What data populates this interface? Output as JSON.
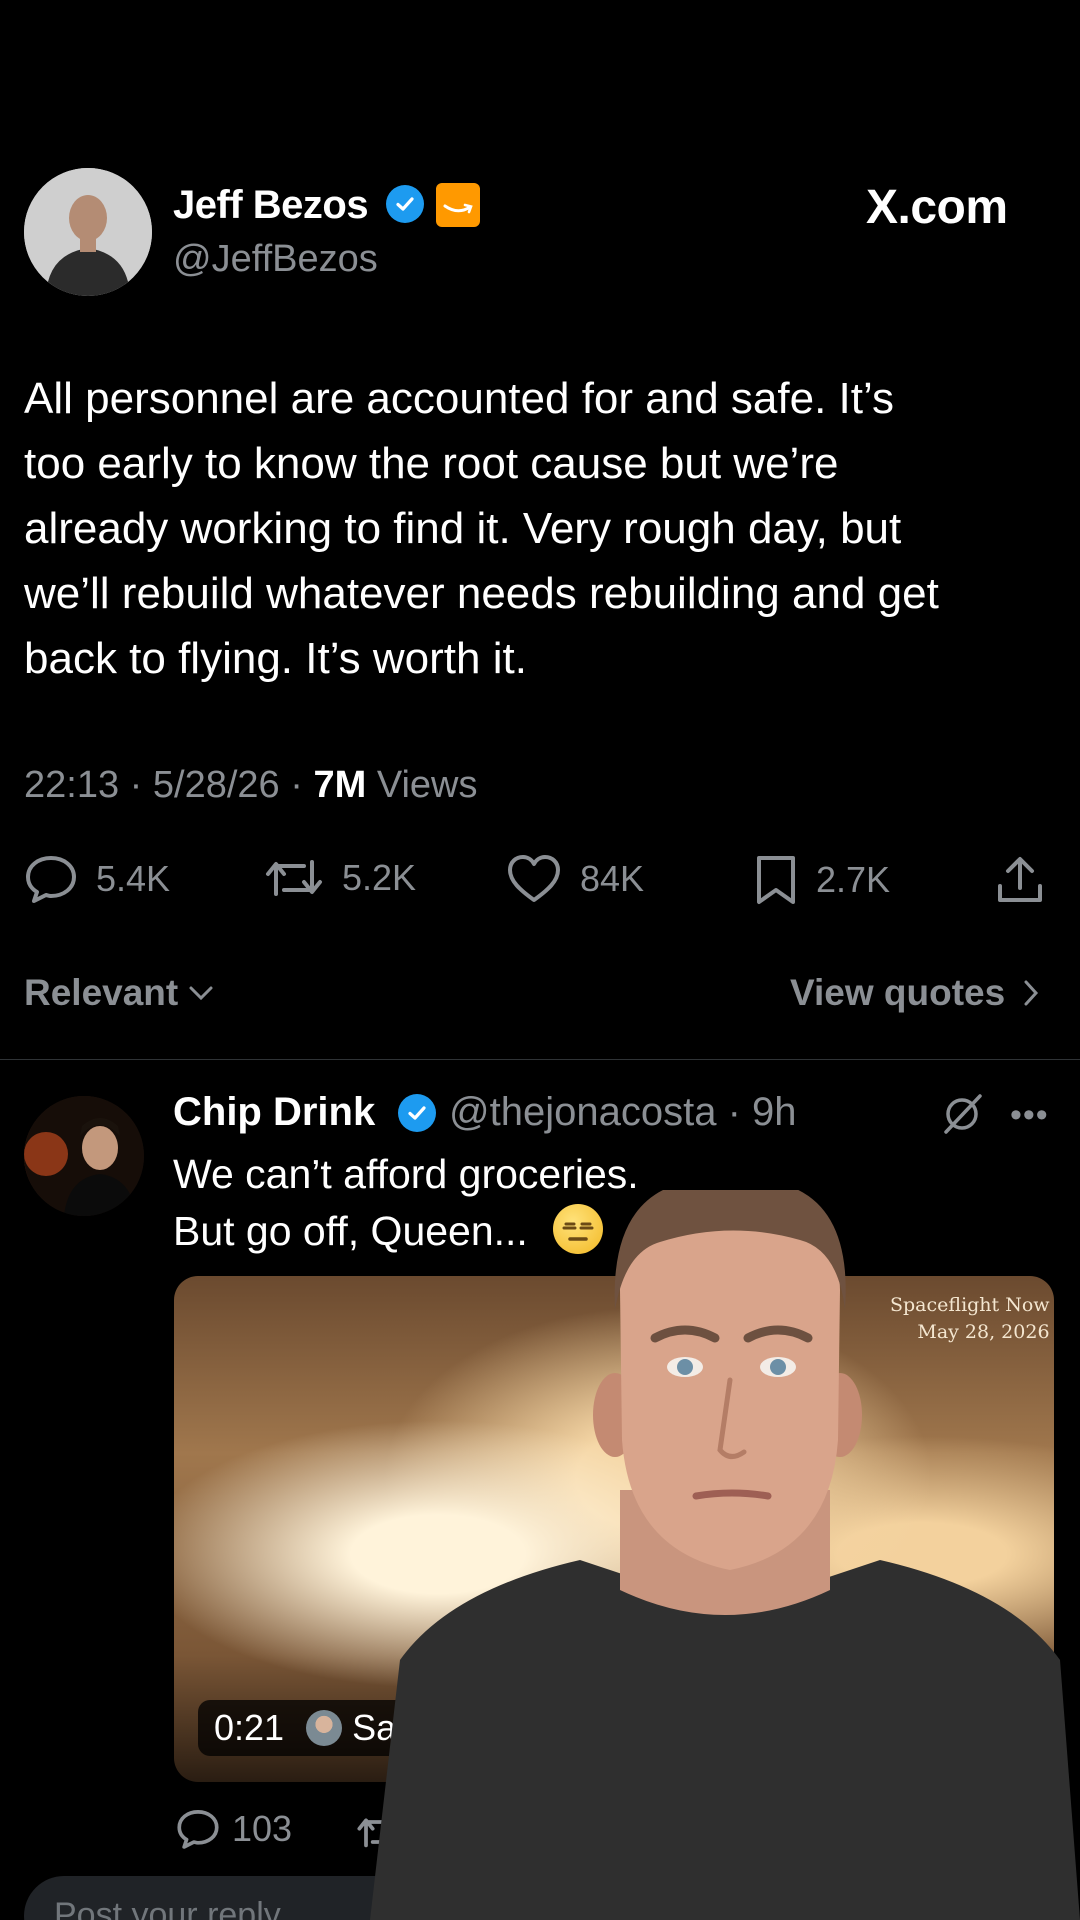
{
  "post": {
    "author": {
      "name": "Jeff Bezos",
      "handle": "@JeffBezos",
      "verified": true,
      "affiliate_badge": "amazon-icon"
    },
    "site_label": "X.com",
    "text": "All personnel are accounted for and safe. It’s\ntoo early to know the root cause but we’re\nalready working to find it. Very rough day, but\nwe’ll rebuild whatever needs rebuilding and get\nback to flying. It’s worth it.",
    "time": "22:13",
    "date": "5/28/26",
    "views_count": "7M",
    "views_label": "Views",
    "stats": {
      "replies": "5.4K",
      "reposts": "5.2K",
      "likes": "84K",
      "bookmarks": "2.7K"
    }
  },
  "sort": {
    "label": "Relevant",
    "view_quotes": "View quotes"
  },
  "reply": {
    "name": "Chip Drink",
    "handle": "@thejonacosta",
    "age": "9h",
    "text": "We can’t afford groceries.\nBut go off, Queen...",
    "emoji": "expressionless-face-emoji",
    "media": {
      "credit_line1": "Spaceflight Now",
      "credit_line2": "May 28, 2026",
      "duration": "0:21",
      "uploader_partial": "Saw"
    },
    "stats": {
      "replies": "103"
    }
  },
  "composer": {
    "placeholder": "Post your reply"
  },
  "colors": {
    "background": "#000000",
    "text_primary": "#ffffff",
    "text_secondary": "#8b8f94",
    "verified_blue": "#1d9bf0",
    "amazon_orange": "#ff9900"
  }
}
